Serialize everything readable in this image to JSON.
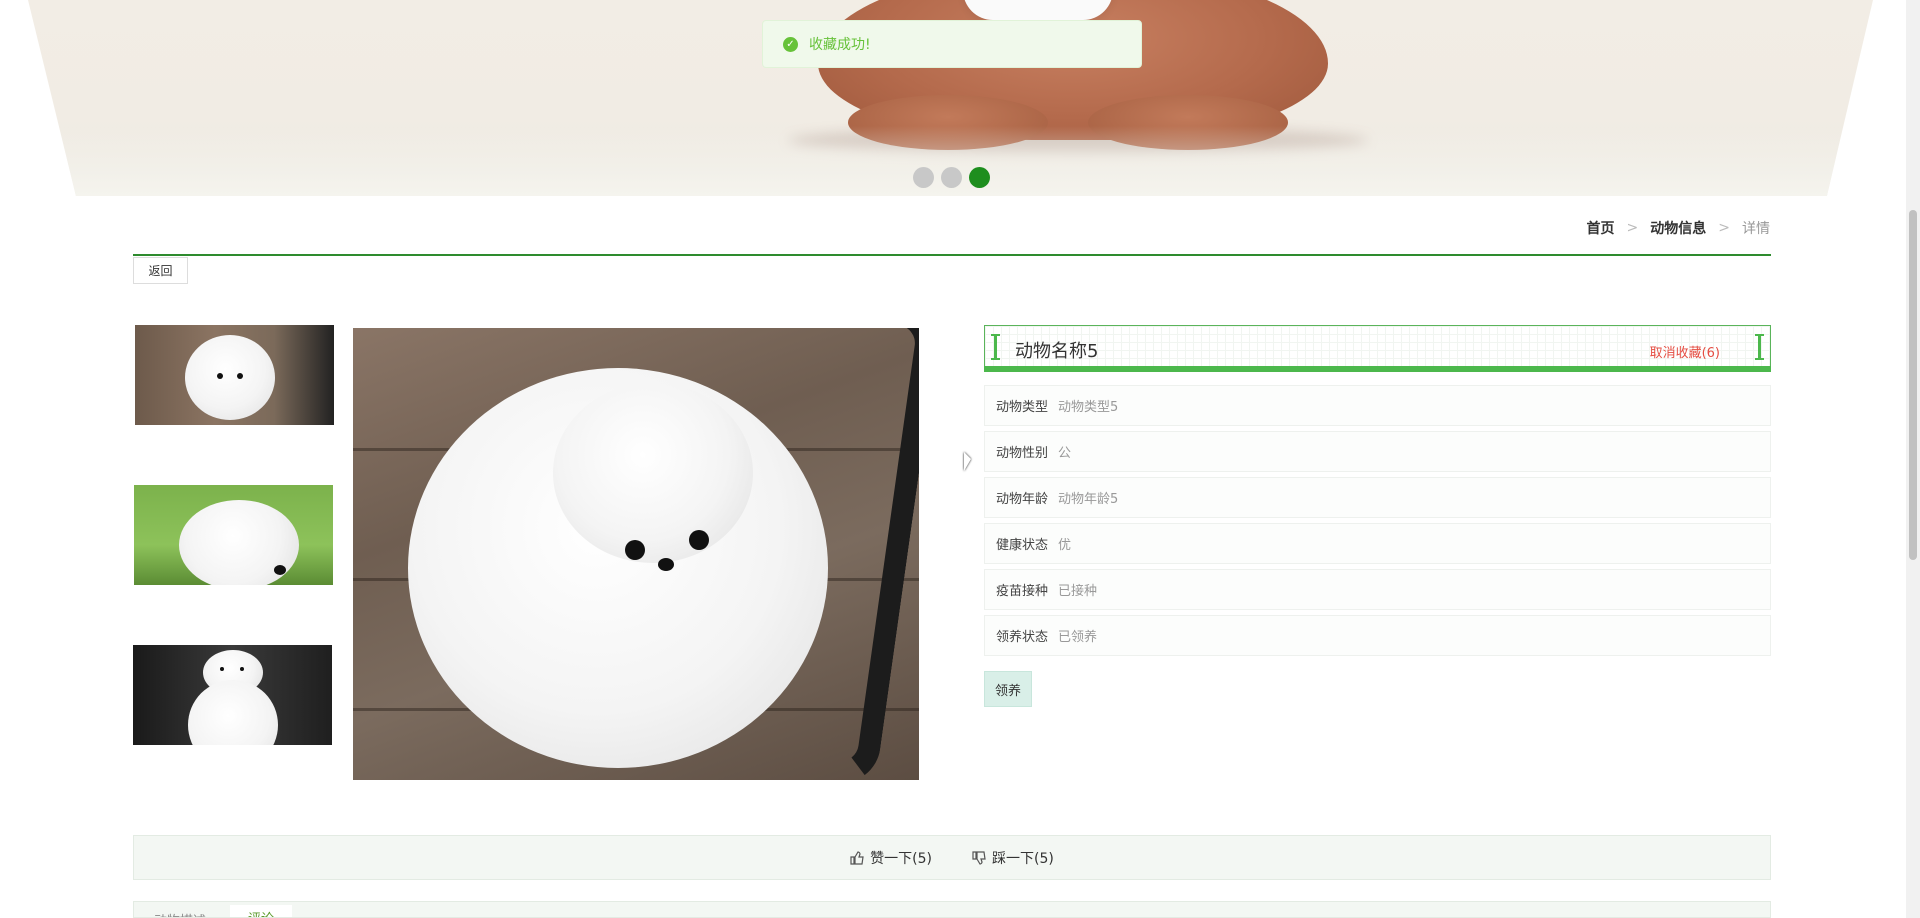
{
  "toast": {
    "message": "收藏成功!"
  },
  "banner": {
    "slides": 3,
    "active_slide": 3
  },
  "breadcrumb": {
    "home": "首页",
    "section": "动物信息",
    "current": "详情",
    "separator": ">"
  },
  "back_button": {
    "label": "返回"
  },
  "animal": {
    "name": "动物名称5",
    "favorite_label": "取消收藏(6)",
    "fields": [
      {
        "key": "动物类型",
        "value": "动物类型5"
      },
      {
        "key": "动物性别",
        "value": "公"
      },
      {
        "key": "动物年龄",
        "value": "动物年龄5"
      },
      {
        "key": "健康状态",
        "value": "优"
      },
      {
        "key": "疫苗接种",
        "value": "已接种"
      },
      {
        "key": "领养状态",
        "value": "已领养"
      }
    ],
    "adopt_label": "领养"
  },
  "votes": {
    "like_label": "赞一下(5)",
    "dislike_label": "踩一下(5)",
    "like_icon": "thumbs-up-icon",
    "dislike_icon": "thumbs-down-icon"
  },
  "tabs": [
    {
      "label": "动物描述"
    },
    {
      "label": "评论"
    }
  ],
  "colors": {
    "accent": "#2e8b2e",
    "success": "#67c23a",
    "danger": "#e54d42"
  }
}
